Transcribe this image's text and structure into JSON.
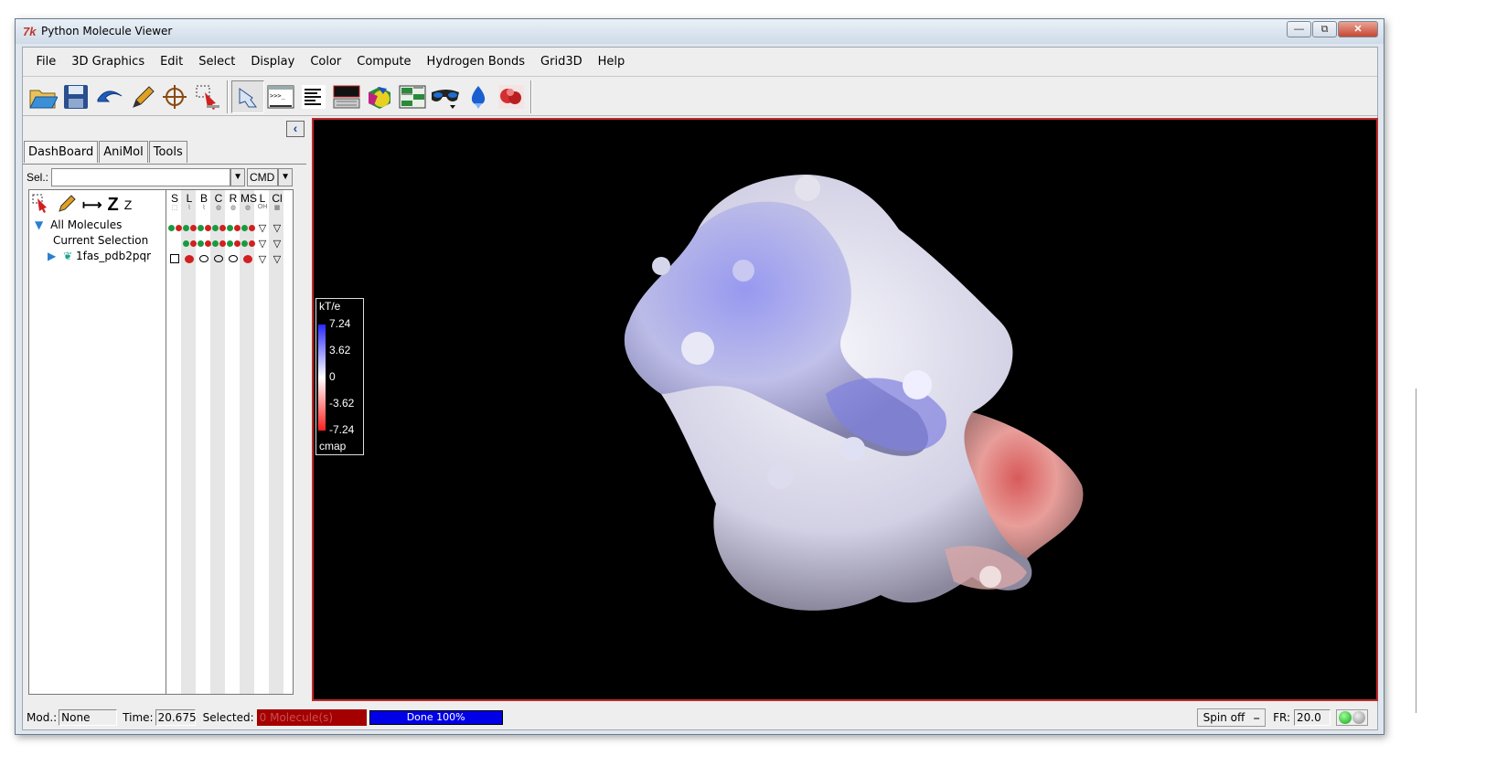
{
  "window": {
    "title": "Python Molecule Viewer",
    "icon_text": "7k",
    "minimize": "—",
    "restore": "⧉",
    "close": "✕"
  },
  "menu": [
    "File",
    "3D Graphics",
    "Edit",
    "Select",
    "Display",
    "Color",
    "Compute",
    "Hydrogen Bonds",
    "Grid3D",
    "Help"
  ],
  "toolbar": {
    "icons": [
      "open-folder-icon",
      "save-icon",
      "undo-icon",
      "pencil-icon",
      "crosshair-icon",
      "select-icon",
      "pick-hand-icon",
      "python-shell-icon",
      "text-lines-icon",
      "message-log-icon",
      "3d-shapes-icon",
      "grid-panel-icon",
      "stereo-glasses-icon",
      "hydrogen-bond-icon",
      "surface-map-icon"
    ]
  },
  "left_panel": {
    "tabs": [
      "DashBoard",
      "AniMol",
      "Tools"
    ],
    "sel_label": "Sel.:",
    "sel_value": "",
    "cmd_label": "CMD",
    "tree_tool_z1": "Z",
    "tree_tool_z2": "Z",
    "tree": [
      {
        "label": "All Molecules",
        "icon": "triangle-down-icon"
      },
      {
        "label": "Current Selection",
        "icon": ""
      },
      {
        "label": "1fas_pdb2pqr",
        "icon": "molecule-icon"
      }
    ],
    "columns": [
      {
        "head": "S",
        "sub": "⬚"
      },
      {
        "head": "L",
        "sub": "⌇"
      },
      {
        "head": "B",
        "sub": "⌇"
      },
      {
        "head": "C",
        "sub": "◍"
      },
      {
        "head": "R",
        "sub": "◍"
      },
      {
        "head": "MS",
        "sub": "◍"
      },
      {
        "head": "L",
        "sub": "OH"
      },
      {
        "head": "Cl",
        "sub": "▦"
      }
    ],
    "colors": {
      "on": "#d02020",
      "alt": "#1a9a40"
    }
  },
  "viewer": {
    "background": "#000000",
    "legend": {
      "title": "kT/e",
      "ticks": [
        "7.24",
        "3.62",
        "0",
        "-3.62",
        "-7.24"
      ],
      "footer": "cmap"
    }
  },
  "status": {
    "mod_label": "Mod.:",
    "mod_value": "None",
    "time_label": "Time:",
    "time_value": "20.675",
    "selected_label": "Selected:",
    "selected_value": "0 Molecule(s)",
    "progress_text": "Done 100%",
    "progress": 1.0,
    "spin_label": "Spin off",
    "fr_label": "FR:",
    "fr_value": "20.0"
  }
}
